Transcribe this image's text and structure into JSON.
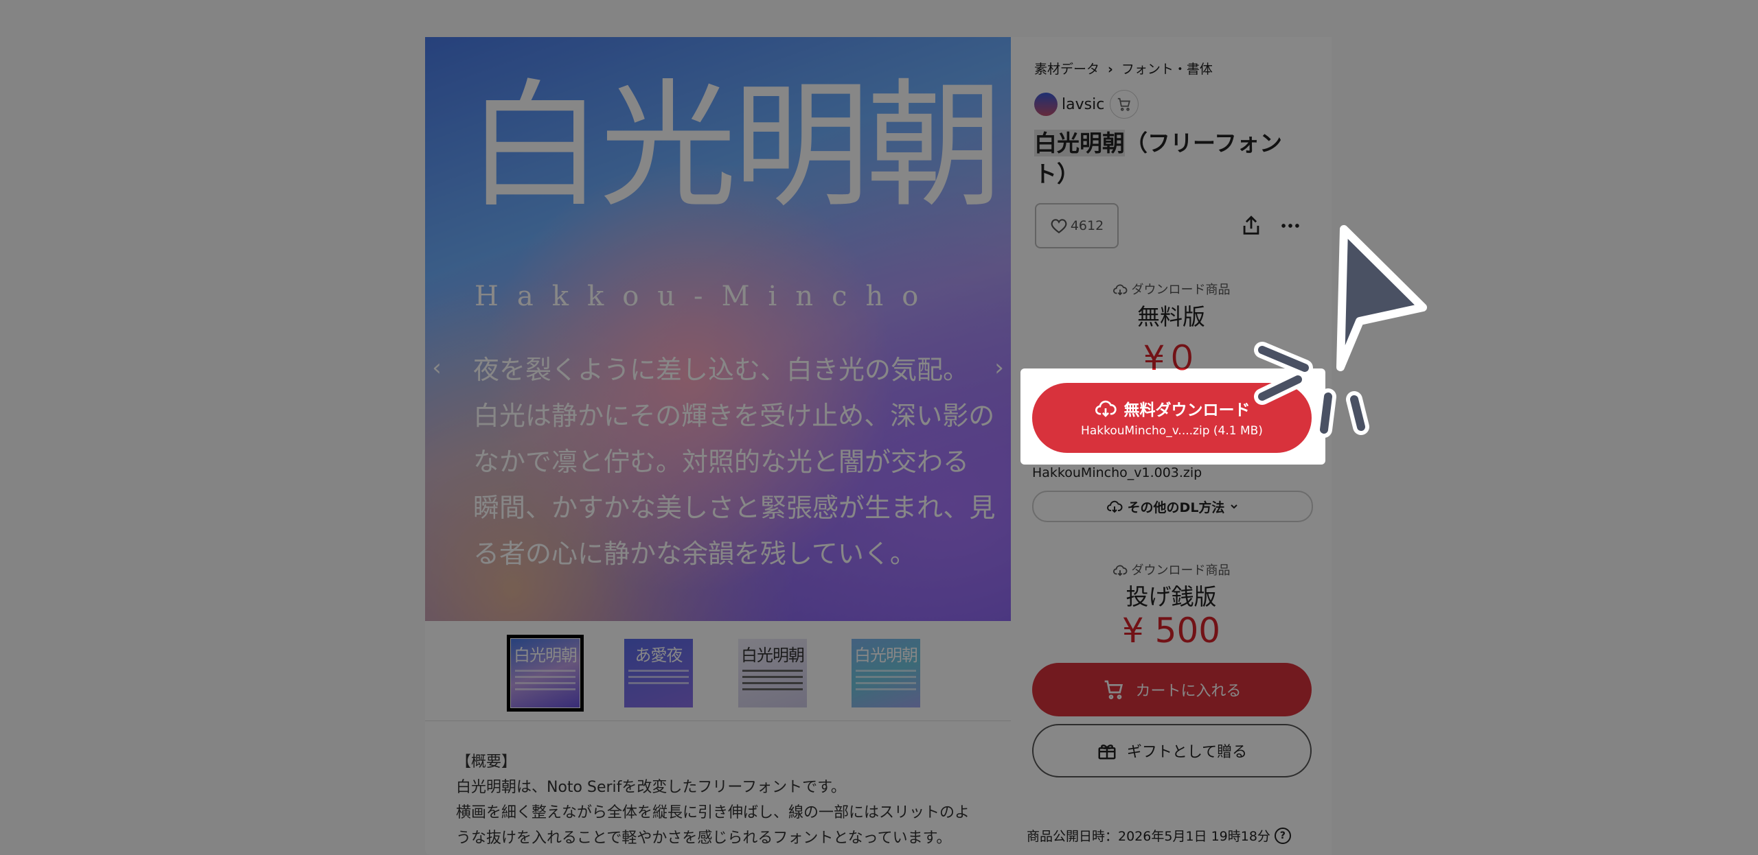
{
  "image": {
    "title": "白光明朝",
    "subtitle": "Hakkou-Mincho",
    "body_lines": [
      "夜を裂くように差し込む、白き光の気配。",
      "白光は静かにその輝きを受け止め、深い影の",
      "なかで凛と佇む。対照的な光と闇が交わる",
      "瞬間、かすかな美しさと緊張感が生まれ、見",
      "る者の心に静かな余韻を残していく。"
    ],
    "prev_arrow": "‹",
    "next_arrow": "›"
  },
  "thumbnails": [
    {
      "text": "白光明朝",
      "selected": true
    },
    {
      "text": "あ愛夜",
      "selected": false
    },
    {
      "text": "白光明朝",
      "selected": false
    },
    {
      "text": "白光明朝",
      "selected": false
    }
  ],
  "description": {
    "heading": "【概要】",
    "lines": [
      "白光明朝は、Noto Serifを改変したフリーフォントです。",
      "横画を細く整えながら全体を縦長に引き伸ばし、線の一部にはスリットのよ",
      "うな抜けを入れることで軽やかさを感じられるフォントとなっています。"
    ]
  },
  "breadcrumb": {
    "level1": "素材データ",
    "separator": "›",
    "level2": "フォント・書体"
  },
  "author": {
    "name": "lavsic"
  },
  "product": {
    "title_highlight": "白光明朝",
    "title_rest": "（フリーフォント）"
  },
  "likes": {
    "count": "4612"
  },
  "free_plan": {
    "type_label": "ダウンロード商品",
    "name": "無料版",
    "price": "¥０",
    "download_button": "無料ダウンロード",
    "download_file": "HakkouMincho_v....zip (4.1 MB)",
    "file_name": "HakkouMincho_v1.003.zip",
    "other_dl": "その他のDL方法"
  },
  "paid_plan": {
    "type_label": "ダウンロード商品",
    "name": "投げ銭版",
    "price": "¥ 500",
    "cart_button": "カートに入れる",
    "gift_button": "ギフトとして贈る"
  },
  "published": {
    "text": "商品公開日時：2026年5月1日 19時18分",
    "help": "?"
  },
  "colors": {
    "accent": "#d8323c",
    "overlay": "rgba(0,0,0,0.47)"
  }
}
